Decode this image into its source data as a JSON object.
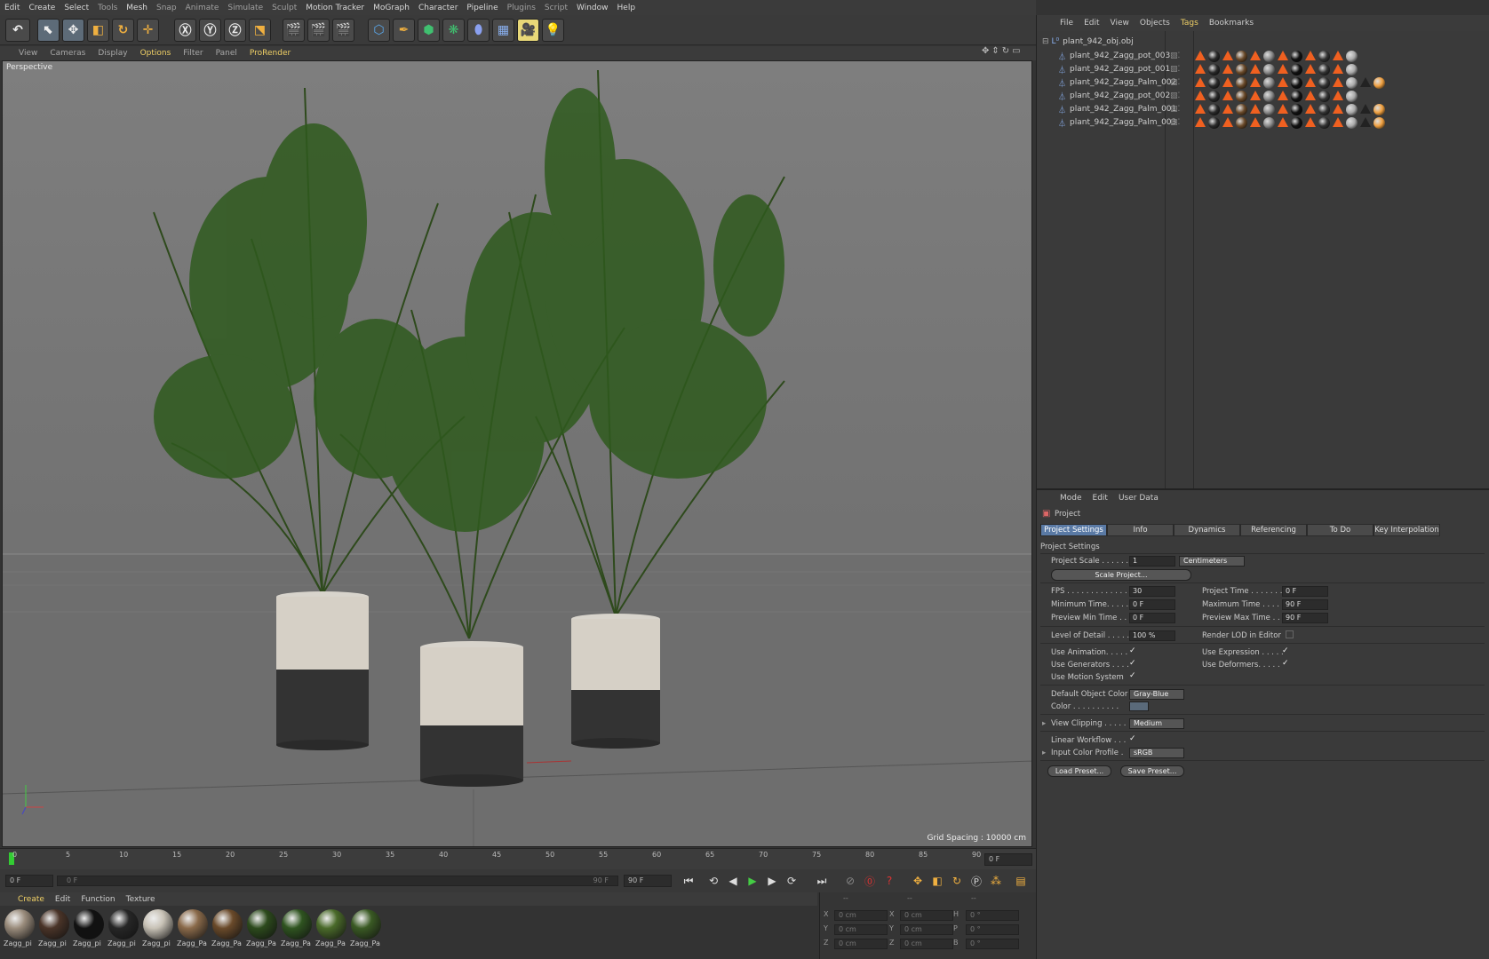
{
  "menu": [
    "Edit",
    "Create",
    "Select",
    "Tools",
    "Mesh",
    "Snap",
    "Animate",
    "Simulate",
    "Sculpt",
    "Motion Tracker",
    "MoGraph",
    "Character",
    "Pipeline",
    "Plugins",
    "Script",
    "Window",
    "Help"
  ],
  "viewport_menu": {
    "items": [
      "View",
      "Cameras",
      "Display",
      "Options",
      "Filter",
      "Panel",
      "ProRender"
    ]
  },
  "viewport": {
    "label": "Perspective",
    "grid_spacing": "Grid Spacing : 10000 cm"
  },
  "timeline": {
    "ticks": [
      "0",
      "5",
      "10",
      "15",
      "20",
      "25",
      "30",
      "35",
      "40",
      "45",
      "50",
      "55",
      "60",
      "65",
      "70",
      "75",
      "80",
      "85",
      "90"
    ],
    "current_frame": "0 F",
    "start_field": "0 F",
    "range_start": "0 F",
    "range_end": "90 F",
    "end_field": "90 F"
  },
  "material_menu": [
    "Create",
    "Edit",
    "Function",
    "Texture"
  ],
  "materials": [
    {
      "label": "Zagg_pi",
      "color": "#9a8c7c"
    },
    {
      "label": "Zagg_pi",
      "color": "#4a3428"
    },
    {
      "label": "Zagg_pi",
      "color": "#111111"
    },
    {
      "label": "Zagg_pi",
      "color": "#262626"
    },
    {
      "label": "Zagg_pi",
      "color": "#c8c2b6"
    },
    {
      "label": "Zagg_Pa",
      "color": "#8a6a4a"
    },
    {
      "label": "Zagg_Pa",
      "color": "#6a4a2a"
    },
    {
      "label": "Zagg_Pa",
      "color": "#2c4a1c"
    },
    {
      "label": "Zagg_Pa",
      "color": "#2f5420"
    },
    {
      "label": "Zagg_Pa",
      "color": "#4a6a2a"
    },
    {
      "label": "Zagg_Pa",
      "color": "#3a5a24"
    }
  ],
  "coords": {
    "header": [
      "--",
      "--",
      "--"
    ],
    "rows": [
      {
        "a": "X",
        "av": "0 cm",
        "b": "X",
        "bv": "0 cm",
        "c": "H",
        "cv": "0 °"
      },
      {
        "a": "Y",
        "av": "0 cm",
        "b": "Y",
        "bv": "0 cm",
        "c": "P",
        "cv": "0 °"
      },
      {
        "a": "Z",
        "av": "0 cm",
        "b": "Z",
        "bv": "0 cm",
        "c": "B",
        "cv": "0 °"
      }
    ]
  },
  "object_manager": {
    "menu": [
      "File",
      "Edit",
      "View",
      "Objects",
      "Tags",
      "Bookmarks"
    ],
    "root": "plant_942_obj.obj",
    "objects": [
      {
        "name": "plant_942_Zagg_pot_003"
      },
      {
        "name": "plant_942_Zagg_pot_001"
      },
      {
        "name": "plant_942_Zagg_Palm_002"
      },
      {
        "name": "plant_942_Zagg_pot_002"
      },
      {
        "name": "plant_942_Zagg_Palm_001"
      },
      {
        "name": "plant_942_Zagg_Palm_003"
      }
    ]
  },
  "attributes": {
    "menu": [
      "Mode",
      "Edit",
      "User Data"
    ],
    "title": "Project",
    "tabs": [
      "Project Settings",
      "Info",
      "Dynamics",
      "Referencing",
      "To Do",
      "Key Interpolation"
    ],
    "section": "Project Settings",
    "project_scale_label": "Project Scale . . . . . .",
    "project_scale": "1",
    "scale_unit": "Centimeters",
    "scale_button": "Scale Project...",
    "fps_label": "FPS . . . . . . . . . . . . .",
    "fps": "30",
    "project_time_label": "Project Time . . . . . . .",
    "project_time": "0 F",
    "min_time_label": "Minimum Time. . . . .",
    "min_time": "0 F",
    "max_time_label": "Maximum Time . . . .",
    "max_time": "90 F",
    "prev_min_label": "Preview Min Time . .",
    "prev_min": "0 F",
    "prev_max_label": "Preview Max Time . . .",
    "prev_max": "90 F",
    "lod_label": "Level of Detail . . . . .",
    "lod": "100 %",
    "render_lod_label": "Render LOD in Editor",
    "use_anim_label": "Use Animation. . . . .",
    "use_expr_label": "Use Expression . . . . .",
    "use_gen_label": "Use Generators . . . .",
    "use_def_label": "Use Deformers. . . . .",
    "use_motion_label": "Use Motion System",
    "default_color_label": "Default Object Color",
    "default_color": "Gray-Blue",
    "color_label": "Color . . . . . . . . . .",
    "clipping_label": "View Clipping . . . . .",
    "clipping": "Medium",
    "linear_label": "Linear Workflow . . .",
    "profile_label": "Input Color Profile .",
    "profile": "sRGB",
    "load_preset": "Load Preset...",
    "save_preset": "Save Preset..."
  }
}
